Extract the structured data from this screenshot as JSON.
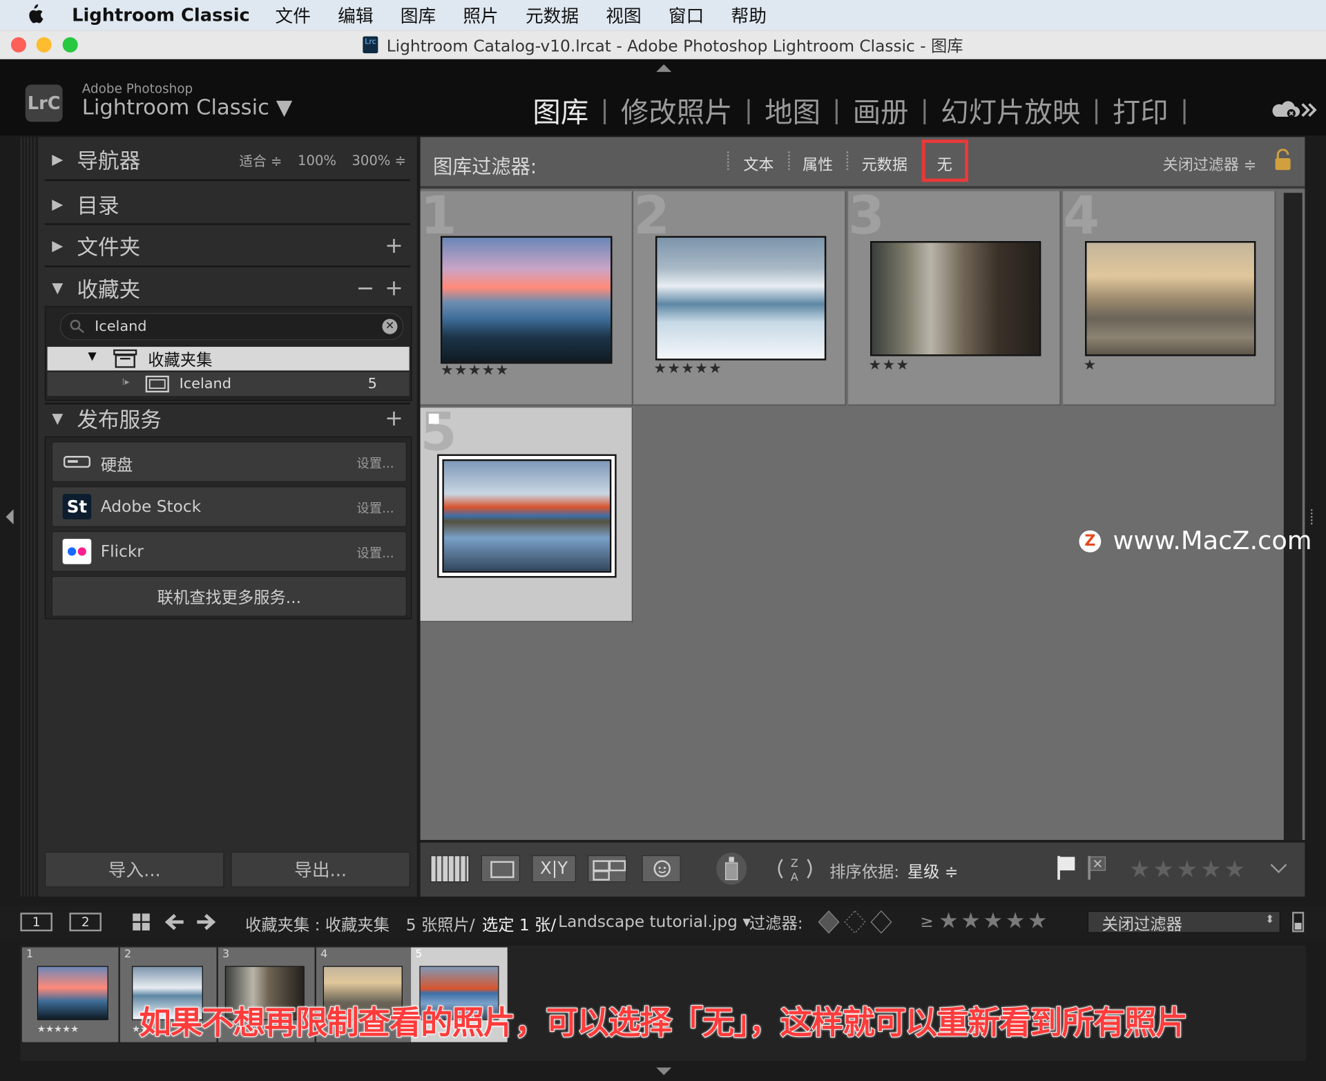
{
  "menubar": {
    "app_name": "Lightroom Classic",
    "items": [
      "文件",
      "编辑",
      "图库",
      "照片",
      "元数据",
      "视图",
      "窗口",
      "帮助"
    ]
  },
  "window": {
    "title": "Lightroom Catalog-v10.lrcat - Adobe Photoshop Lightroom Classic - 图库",
    "catalog_icon_text": "Lrc"
  },
  "header": {
    "badge": "LrC",
    "brand_small": "Adobe Photoshop",
    "brand_big": "Lightroom Classic ▼",
    "modules": [
      "图库",
      "修改照片",
      "地图",
      "画册",
      "幻灯片放映",
      "打印"
    ],
    "active_module": "图库"
  },
  "left_panel": {
    "navigator": {
      "title": "导航器",
      "zoom_fit": "适合 ≑",
      "zoom_100": "100%",
      "zoom_300": "300% ≑"
    },
    "catalog": {
      "title": "目录"
    },
    "folders": {
      "title": "文件夹",
      "plus": "+"
    },
    "collections": {
      "title": "收藏夹",
      "minus": "−",
      "plus": "+",
      "search_value": "Iceland",
      "collection_set": "收藏夹集",
      "collection_name": "Iceland",
      "collection_count": "5"
    },
    "publish": {
      "title": "发布服务",
      "plus": "+",
      "services": [
        {
          "name": "硬盘",
          "setup": "设置..."
        },
        {
          "name": "Adobe Stock",
          "setup": "设置...",
          "icon_text": "St"
        },
        {
          "name": "Flickr",
          "setup": "设置..."
        }
      ],
      "find_more": "联机查找更多服务..."
    },
    "import_label": "导入...",
    "export_label": "导出..."
  },
  "filter_bar": {
    "title": "图库过滤器:",
    "options": [
      "文本",
      "属性",
      "元数据",
      "无"
    ],
    "highlighted": "无",
    "close_filter": "关闭过滤器 ≑"
  },
  "grid": {
    "cells": [
      {
        "index": "1",
        "stars": "★★★★★"
      },
      {
        "index": "2",
        "stars": "★★★★★"
      },
      {
        "index": "3",
        "stars": "★★★"
      },
      {
        "index": "4",
        "stars": "★"
      },
      {
        "index": "5",
        "stars": ""
      }
    ]
  },
  "toolbar": {
    "sort_label": "排序依据:",
    "sort_value": "星级 ≑",
    "stars": "★★★★★"
  },
  "filmstrip_bar": {
    "page1": "1",
    "page2": "2",
    "source": "收藏夹集 : 收藏夹集",
    "count": "5 张照片/",
    "selected": "选定 1 张/",
    "filename": "Landscape tutorial.jpg ▾",
    "filter_label": "过滤器:",
    "ge": "≥",
    "stars": "★★★★★",
    "close_filter": "关闭过滤器"
  },
  "filmstrip": {
    "cells": [
      {
        "index": "1",
        "stars": "★★★★★"
      },
      {
        "index": "2",
        "stars": "★★"
      },
      {
        "index": "3",
        "stars": ""
      },
      {
        "index": "4",
        "stars": ""
      },
      {
        "index": "5",
        "stars": ""
      }
    ]
  },
  "caption": "如果不想再限制查看的照片，可以选择「无」，这样就可以重新看到所有照片",
  "watermark": {
    "logo": "Z",
    "text": "www.MacZ.com"
  },
  "colors": {
    "highlight": "#e83a3a",
    "caption": "#ff3b3b",
    "traffic_close": "#fe5f57",
    "traffic_min": "#febc2e",
    "traffic_max": "#28c840"
  }
}
